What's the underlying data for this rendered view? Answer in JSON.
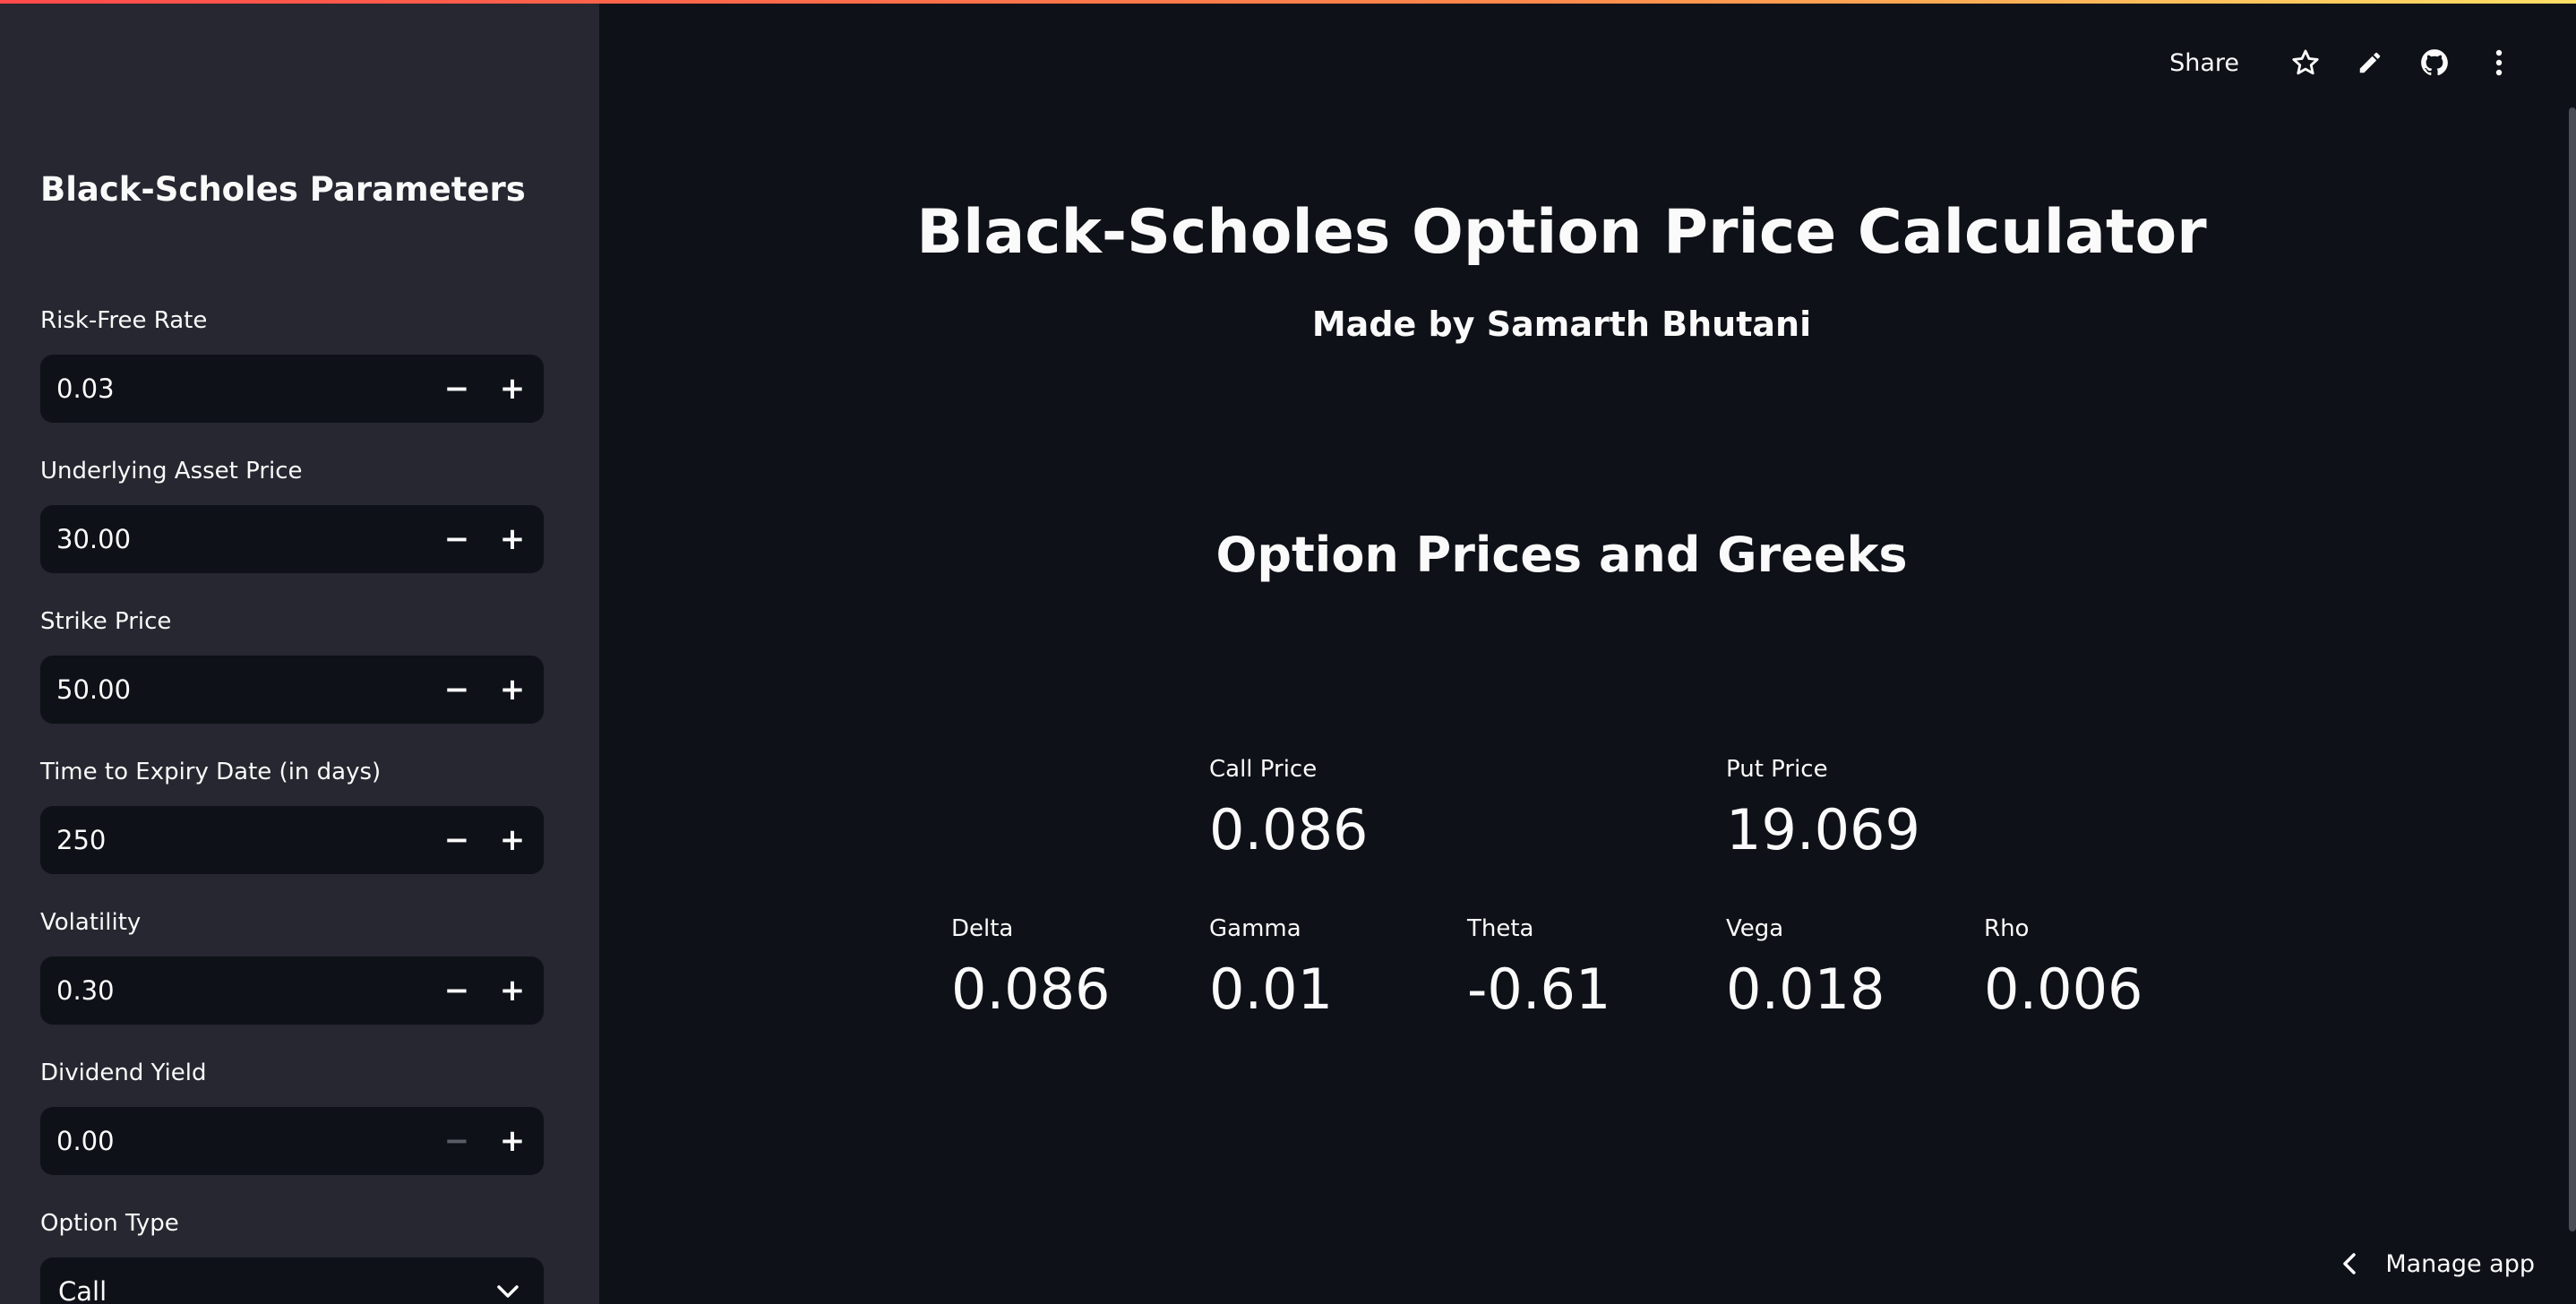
{
  "sidebar": {
    "title": "Black-Scholes Parameters",
    "fields": [
      {
        "label": "Risk-Free Rate",
        "value": "0.03",
        "minus_disabled": false
      },
      {
        "label": "Underlying Asset Price",
        "value": "30.00",
        "minus_disabled": false
      },
      {
        "label": "Strike Price",
        "value": "50.00",
        "minus_disabled": false
      },
      {
        "label": "Time to Expiry Date (in days)",
        "value": "250",
        "minus_disabled": false
      },
      {
        "label": "Volatility",
        "value": "0.30",
        "minus_disabled": false
      },
      {
        "label": "Dividend Yield",
        "value": "0.00",
        "minus_disabled": true
      }
    ],
    "option_type": {
      "label": "Option Type",
      "value": "Call"
    },
    "minus_glyph": "−",
    "plus_glyph": "+"
  },
  "toolbar": {
    "share_label": "Share",
    "icons": [
      "star-icon",
      "pencil-icon",
      "github-icon",
      "more-vert-icon"
    ]
  },
  "main": {
    "title": "Black-Scholes Option Price Calculator",
    "subtitle": "Made by Samarth Bhutani",
    "section_title": "Option Prices and Greeks",
    "prices": [
      {
        "label": "Call Price",
        "value": "0.086"
      },
      {
        "label": "Put Price",
        "value": "19.069"
      }
    ],
    "greeks": [
      {
        "label": "Delta",
        "value": "0.086"
      },
      {
        "label": "Gamma",
        "value": "0.01"
      },
      {
        "label": "Theta",
        "value": "-0.61"
      },
      {
        "label": "Vega",
        "value": "0.018"
      },
      {
        "label": "Rho",
        "value": "0.006"
      }
    ]
  },
  "footer": {
    "manage_app_label": "Manage app"
  },
  "colors": {
    "background": "#0e1117",
    "sidebar": "#262730",
    "text": "#fafafa",
    "accent_start": "#ff4b4b",
    "accent_end": "#ffe066"
  }
}
